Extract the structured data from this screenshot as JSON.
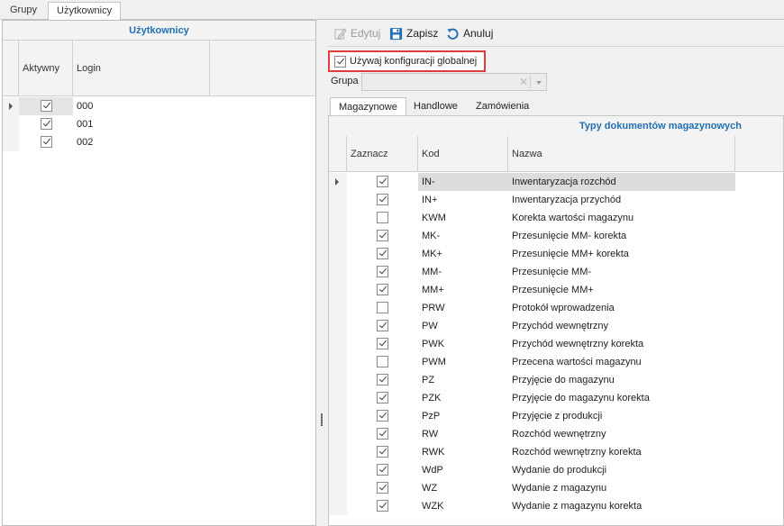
{
  "top_tabs": [
    "Grupy",
    "Użytkownicy"
  ],
  "users": {
    "title": "Użytkownicy",
    "columns": [
      "Aktywny",
      "Login"
    ],
    "rows": [
      {
        "active": true,
        "login": "000"
      },
      {
        "active": true,
        "login": "001"
      },
      {
        "active": true,
        "login": "002"
      }
    ]
  },
  "toolbar": {
    "edit_label": "Edytuj",
    "save_label": "Zapisz",
    "cancel_label": "Anuluj"
  },
  "global_config": {
    "label": "Używaj konfiguracji globalnej",
    "checked": true
  },
  "group": {
    "label": "Grupa",
    "value": ""
  },
  "sub_tabs": [
    "Magazynowe",
    "Handlowe",
    "Zamówienia"
  ],
  "docs": {
    "title": "Typy dokumentów magazynowych",
    "columns": [
      "Zaznacz",
      "Kod",
      "Nazwa"
    ],
    "rows": [
      {
        "checked": true,
        "kod": "IN-",
        "nazwa": "Inwentaryzacja rozchód"
      },
      {
        "checked": true,
        "kod": "IN+",
        "nazwa": "Inwentaryzacja przychód"
      },
      {
        "checked": false,
        "kod": "KWM",
        "nazwa": "Korekta wartości magazynu"
      },
      {
        "checked": true,
        "kod": "MK-",
        "nazwa": "Przesunięcie MM- korekta"
      },
      {
        "checked": true,
        "kod": "MK+",
        "nazwa": "Przesunięcie MM+ korekta"
      },
      {
        "checked": true,
        "kod": "MM-",
        "nazwa": "Przesunięcie MM-"
      },
      {
        "checked": true,
        "kod": "MM+",
        "nazwa": "Przesunięcie MM+"
      },
      {
        "checked": false,
        "kod": "PRW",
        "nazwa": "Protokół wprowadzenia"
      },
      {
        "checked": true,
        "kod": "PW",
        "nazwa": "Przychód wewnętrzny"
      },
      {
        "checked": true,
        "kod": "PWK",
        "nazwa": "Przychód wewnętrzny korekta"
      },
      {
        "checked": false,
        "kod": "PWM",
        "nazwa": "Przecena wartości magazynu"
      },
      {
        "checked": true,
        "kod": "PZ",
        "nazwa": "Przyjęcie do magazynu"
      },
      {
        "checked": true,
        "kod": "PZK",
        "nazwa": "Przyjęcie do magazynu korekta"
      },
      {
        "checked": true,
        "kod": "PzP",
        "nazwa": "Przyjęcie z produkcji"
      },
      {
        "checked": true,
        "kod": "RW",
        "nazwa": "Rozchód wewnętrzny"
      },
      {
        "checked": true,
        "kod": "RWK",
        "nazwa": "Rozchód wewnętrzny korekta"
      },
      {
        "checked": true,
        "kod": "WdP",
        "nazwa": "Wydanie do produkcji"
      },
      {
        "checked": true,
        "kod": "WZ",
        "nazwa": "Wydanie z magazynu"
      },
      {
        "checked": true,
        "kod": "WZK",
        "nazwa": "Wydanie z magazynu korekta"
      }
    ]
  },
  "icons": {
    "edit": "pencil-icon",
    "save": "floppy-disk-icon",
    "cancel": "undo-arrow-icon"
  },
  "colors": {
    "accent_title": "#1f6fb5",
    "highlight_border": "#e03c3c",
    "save_icon": "#1f6fb5"
  }
}
